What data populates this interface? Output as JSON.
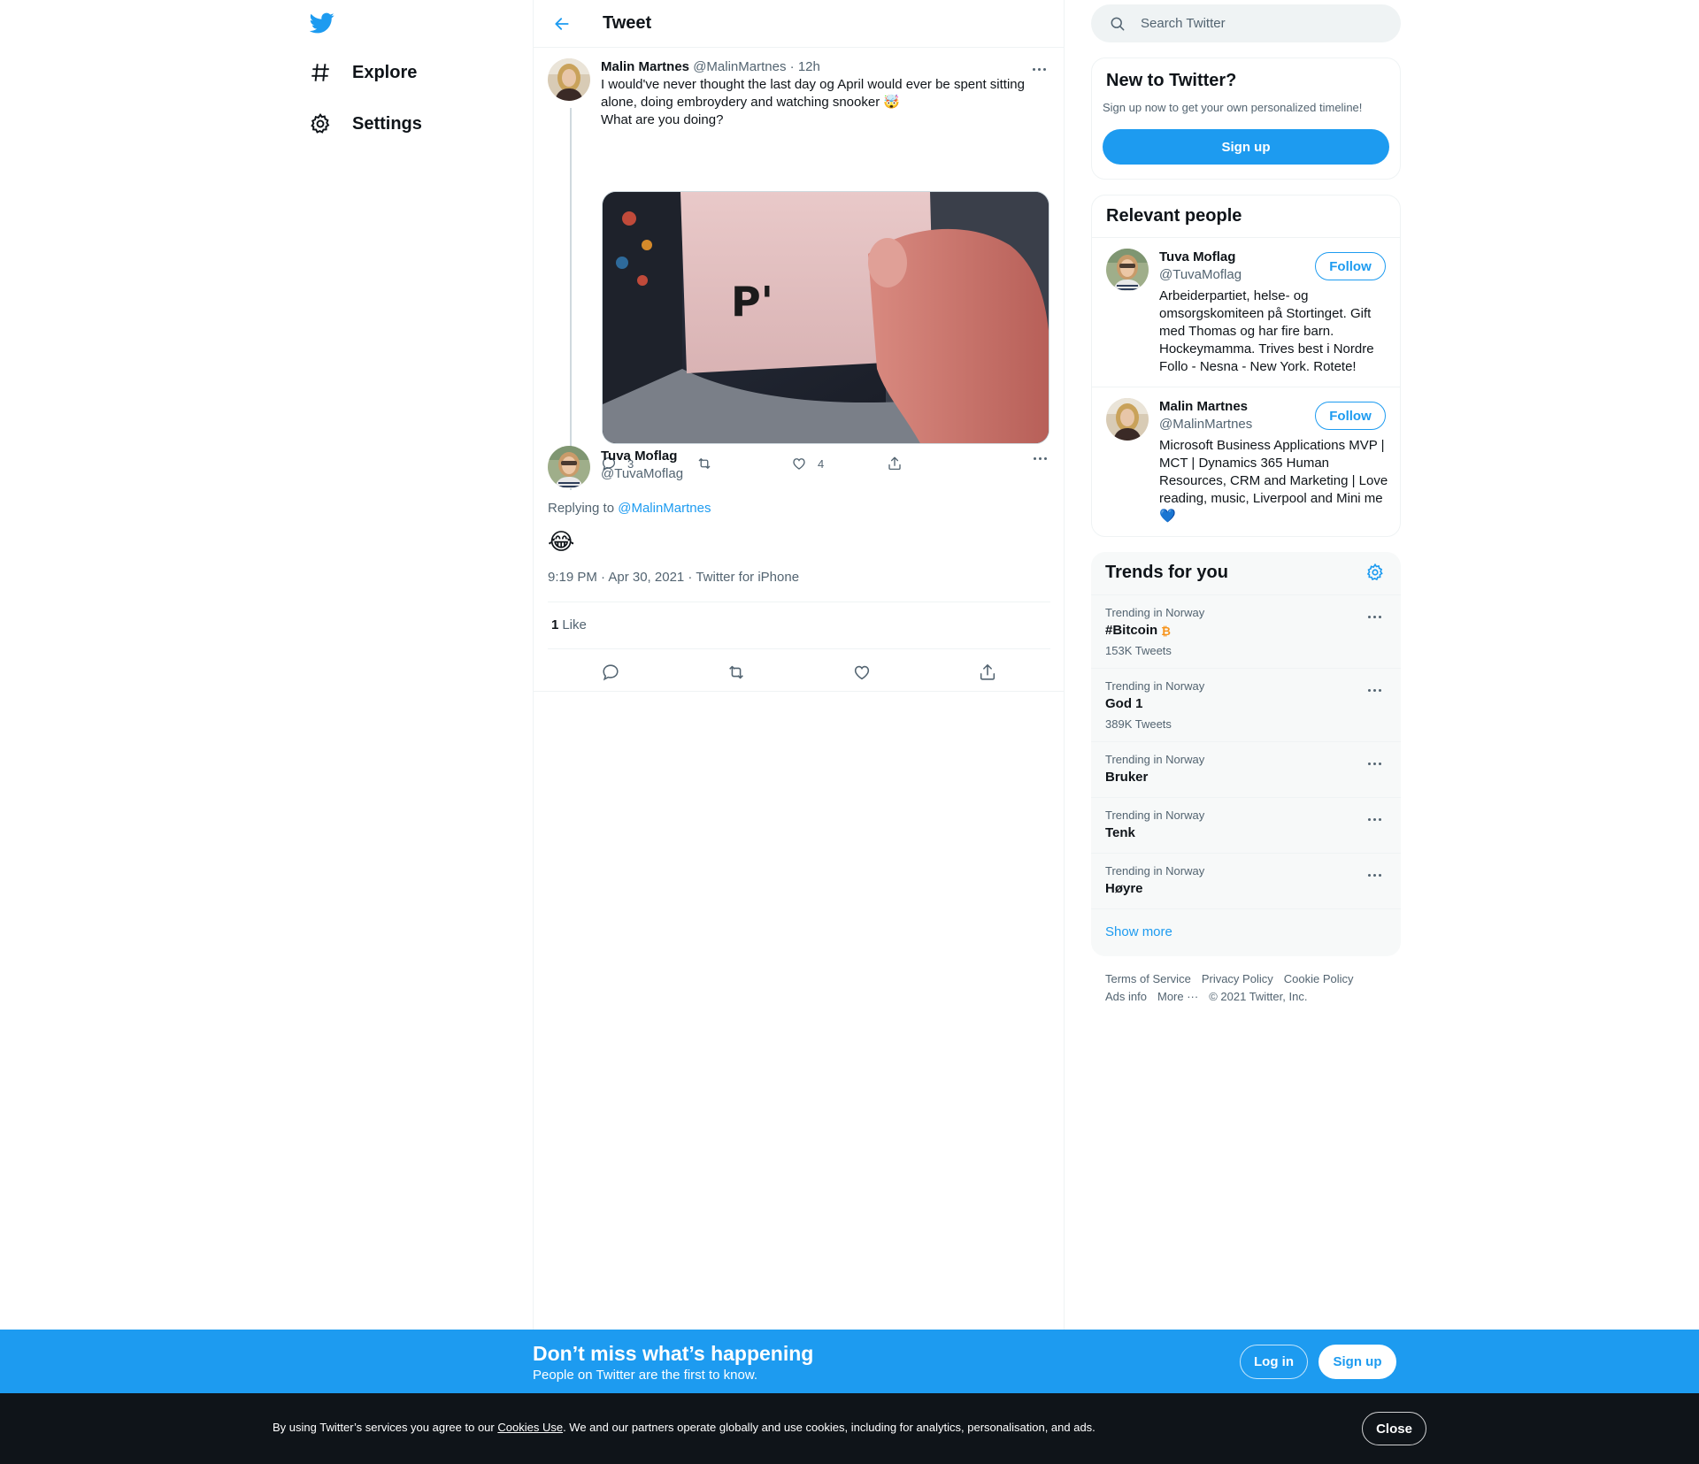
{
  "colors": {
    "accent": "#1d9bf0",
    "text": "#0f1419",
    "muted": "#536471",
    "border": "#eff3f4",
    "cookie_bg": "#0f1419"
  },
  "nav": {
    "logo_icon": "twitter-bird-icon",
    "items": [
      {
        "label": "Explore",
        "icon": "hashtag-icon"
      },
      {
        "label": "Settings",
        "icon": "gear-icon"
      }
    ]
  },
  "header": {
    "back_icon": "arrow-left-icon",
    "title": "Tweet"
  },
  "parent_tweet": {
    "name": "Malin Martnes",
    "handle": "@MalinMartnes",
    "time": "12h",
    "text_line1": "I would've never thought the last day og April would ever be spent sitting alone, doing embroydery and watching snooker 🤯",
    "text_line2": "What are you doing?",
    "media_text": "P'",
    "replies": "3",
    "retweets": "",
    "likes": "4"
  },
  "main_tweet": {
    "name": "Tuva Moflag",
    "handle": "@TuvaMoflag",
    "replying_prefix": "Replying to ",
    "replying_to": "@MalinMartnes",
    "text": "😂",
    "timestamp": "9:19 PM · Apr 30, 2021 · Twitter for iPhone",
    "like_count": "1",
    "like_label": "Like"
  },
  "search": {
    "placeholder": "Search Twitter"
  },
  "new_to_twitter": {
    "title": "New to Twitter?",
    "subtitle": "Sign up now to get your own personalized timeline!",
    "button": "Sign up"
  },
  "relevant_people": {
    "title": "Relevant people",
    "people": [
      {
        "name": "Tuva Moflag",
        "handle": "@TuvaMoflag",
        "bio": "Arbeiderpartiet, helse- og omsorgskomiteen på Stortinget. Gift med Thomas og har fire barn. Hockeymamma. Trives best i Nordre Follo - Nesna - New York. Rotete!",
        "button": "Follow"
      },
      {
        "name": "Malin Martnes",
        "handle": "@MalinMartnes",
        "bio": "Microsoft Business Applications MVP | MCT | Dynamics 365 Human Resources, CRM and Marketing | Love reading, music, Liverpool and Mini me 💙",
        "button": "Follow"
      }
    ]
  },
  "trends": {
    "title": "Trends for you",
    "items": [
      {
        "context": "Trending in Norway",
        "name": "#Bitcoin",
        "count": "153K Tweets"
      },
      {
        "context": "Trending in Norway",
        "name": "God 1",
        "count": "389K Tweets"
      },
      {
        "context": "Trending in Norway",
        "name": "Bruker",
        "count": ""
      },
      {
        "context": "Trending in Norway",
        "name": "Tenk",
        "count": ""
      },
      {
        "context": "Trending in Norway",
        "name": "Høyre",
        "count": ""
      }
    ],
    "show_more": "Show more"
  },
  "footer": {
    "links_row1": [
      "Terms of Service",
      "Privacy Policy",
      "Cookie Policy"
    ],
    "links_row2": [
      "Ads info",
      "More ···",
      "© 2021 Twitter, Inc."
    ]
  },
  "promo": {
    "heading": "Don’t miss what’s happening",
    "sub": "People on Twitter are the first to know.",
    "login": "Log in",
    "signup": "Sign up"
  },
  "cookie": {
    "prefix": "By using Twitter’s services you agree to our ",
    "link": "Cookies Use",
    "suffix": ". We and our partners operate globally and use cookies, including for analytics, personalisation, and ads.",
    "close": "Close"
  }
}
